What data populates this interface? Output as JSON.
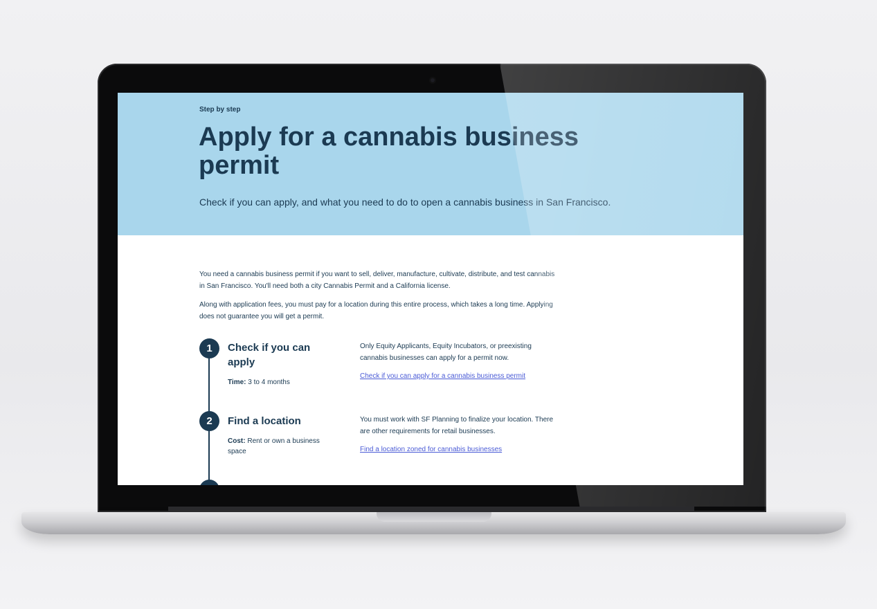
{
  "hero": {
    "eyebrow": "Step by step",
    "title": "Apply for a cannabis business permit",
    "subtitle": "Check if you can apply, and what you need to do to open a cannabis business in San Francisco."
  },
  "intro": [
    "You need a cannabis business permit if you want to sell, deliver, manufacture, cultivate, distribute, and test cannabis in San Francisco. You'll need both a city Cannabis Permit and a California license.",
    "Along with application fees, you must pay for a location during this entire process, which takes a long time. Applying does not guarantee you will get a permit."
  ],
  "steps": [
    {
      "number": "1",
      "title": "Check if you can apply",
      "meta_label": "Time:",
      "meta_value": "3 to 4 months",
      "description": "Only Equity Applicants, Equity Incubators, or preexisting cannabis businesses can apply for a permit now.",
      "link": "Check if you can apply for a cannabis business permit"
    },
    {
      "number": "2",
      "title": "Find a location",
      "meta_label": "Cost:",
      "meta_value": "Rent or own a business space",
      "description": "You must work with SF Planning to finalize your location. There are other requirements for retail businesses.",
      "link": "Find a location zoned for cannabis businesses"
    }
  ],
  "colors": {
    "hero_bg": "#a9d6ec",
    "text_navy": "#1b3a52",
    "link": "#4a5bd6"
  }
}
